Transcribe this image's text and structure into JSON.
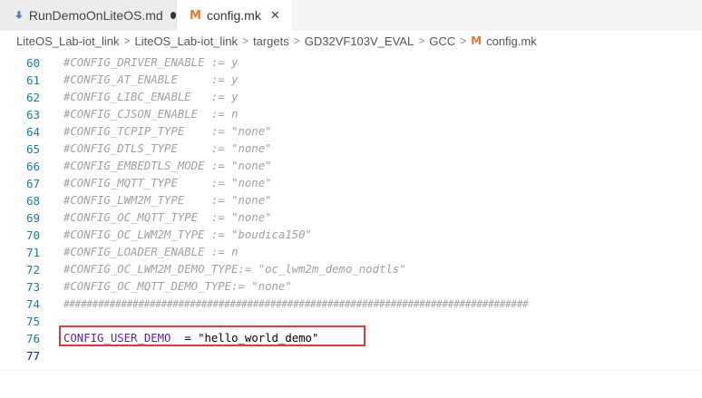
{
  "tabs": [
    {
      "label": "RunDemoOnLiteOS.md",
      "icon": "markdown-icon",
      "dirty": true
    },
    {
      "label": "config.mk",
      "icon": "makefile-icon",
      "active": true,
      "icon_glyph": "M"
    }
  ],
  "breadcrumb": {
    "items": [
      "LiteOS_Lab-iot_link",
      "LiteOS_Lab-iot_link",
      "targets",
      "GD32VF103V_EVAL",
      "GCC",
      "config.mk"
    ],
    "separator": ">"
  },
  "editor": {
    "lines": [
      {
        "num": "60",
        "text": "#CONFIG_DRIVER_ENABLE := y"
      },
      {
        "num": "61",
        "text": "#CONFIG_AT_ENABLE     := y"
      },
      {
        "num": "62",
        "text": "#CONFIG_LIBC_ENABLE   := y"
      },
      {
        "num": "63",
        "text": "#CONFIG_CJSON_ENABLE  := n"
      },
      {
        "num": "64",
        "text": "#CONFIG_TCPIP_TYPE    := \"none\""
      },
      {
        "num": "65",
        "text": "#CONFIG_DTLS_TYPE     := \"none\""
      },
      {
        "num": "66",
        "text": "#CONFIG_EMBEDTLS_MODE := \"none\""
      },
      {
        "num": "67",
        "text": "#CONFIG_MQTT_TYPE     := \"none\""
      },
      {
        "num": "68",
        "text": "#CONFIG_LWM2M_TYPE    := \"none\""
      },
      {
        "num": "69",
        "text": "#CONFIG_OC_MQTT_TYPE  := \"none\""
      },
      {
        "num": "70",
        "text": "#CONFIG_OC_LWM2M_TYPE := \"boudica150\""
      },
      {
        "num": "71",
        "text": "#CONFIG_LOADER_ENABLE := n"
      },
      {
        "num": "72",
        "text": "#CONFIG_OC_LWM2M_DEMO_TYPE:= \"oc_lwm2m_demo_nodtls\""
      },
      {
        "num": "73",
        "text": "#CONFIG_OC_MQTT_DEMO_TYPE:= \"none\""
      },
      {
        "num": "74",
        "text": "#################################################################################"
      },
      {
        "num": "75",
        "text": ""
      },
      {
        "num": "76",
        "key": "CONFIG_USER_DEMO",
        "op": "  = ",
        "value": "\"hello_world_demo\""
      },
      {
        "num": "77",
        "text": ""
      }
    ]
  },
  "colors": {
    "line_number": "#237893",
    "comment": "#a0a0a0",
    "variable": "#5c2699",
    "highlight_border": "#e53935",
    "current_line": "#eef6e8",
    "makefile_icon": "#e37933"
  }
}
